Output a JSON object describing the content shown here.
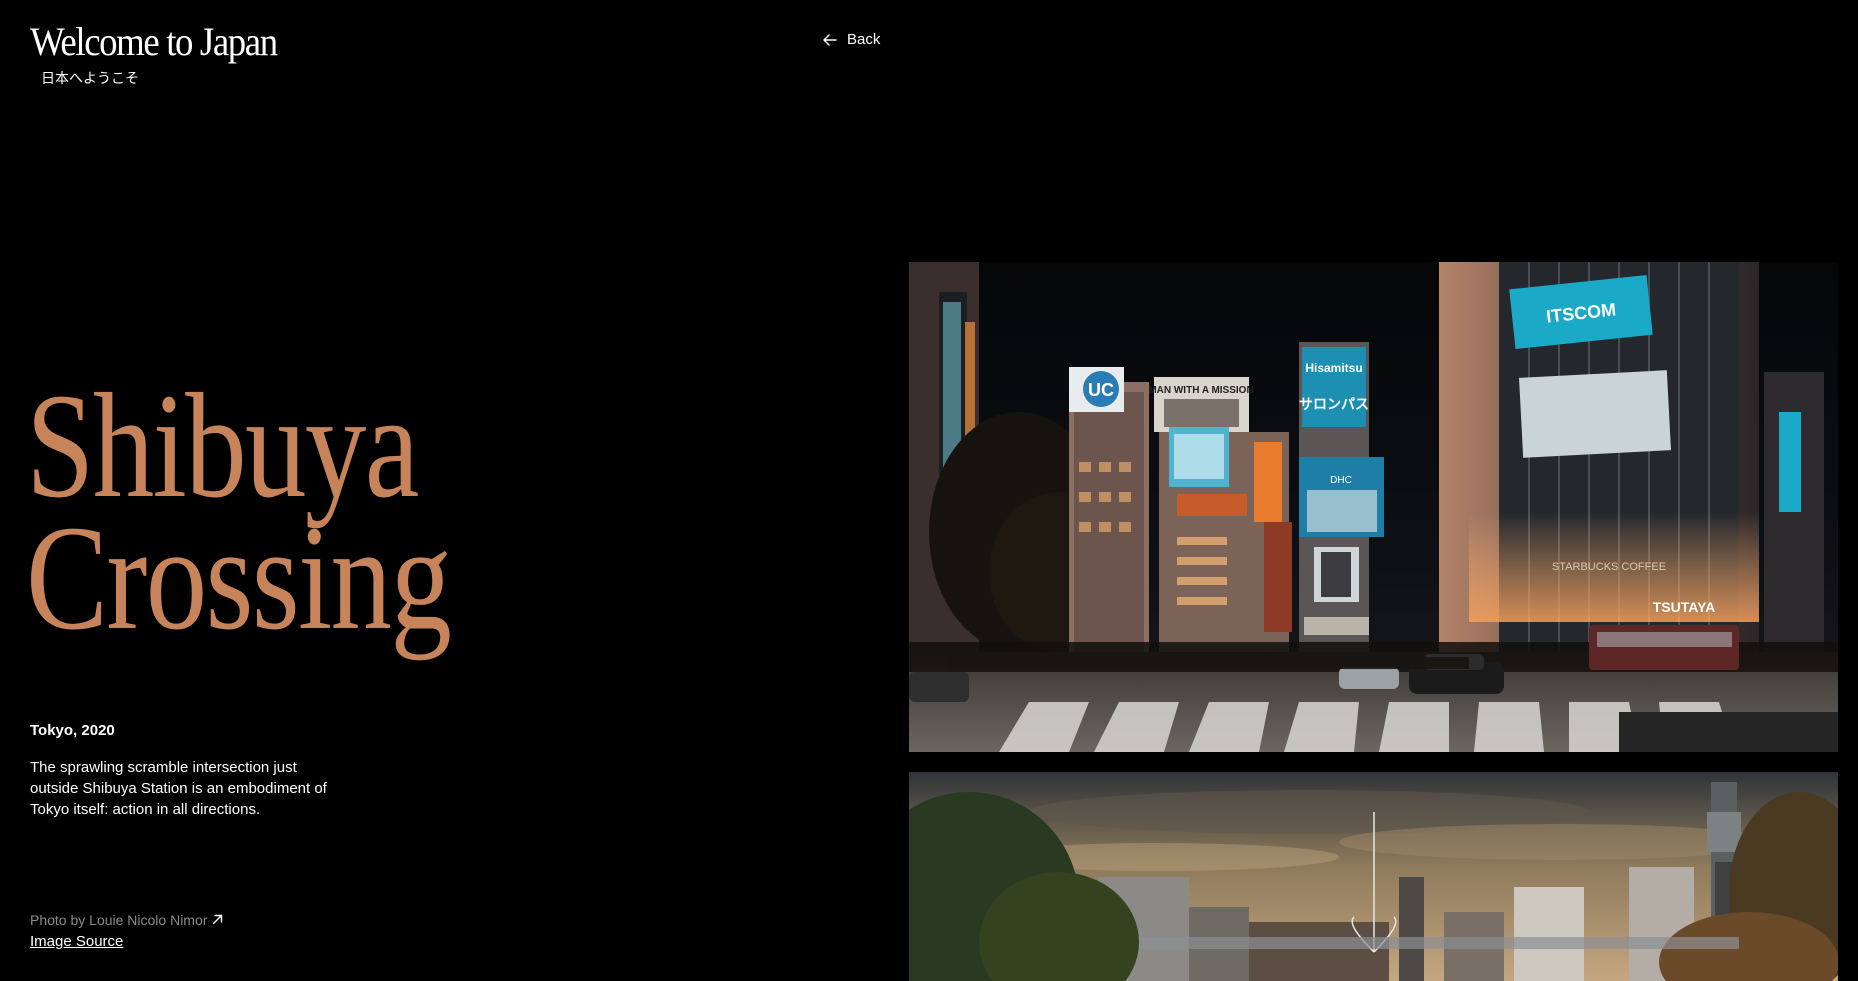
{
  "header": {
    "title": "Welcome to Japan",
    "subtitle": "日本へようこそ",
    "back_label": "Back",
    "back_icon": "arrow-left-icon"
  },
  "hero": {
    "title_line1": "Shibuya",
    "title_line2": "Crossing",
    "title_color": "#c7835a"
  },
  "details": {
    "location": "Tokyo, 2020",
    "description": "The sprawling scramble intersection just outside Shibuya Station is an embodiment of Tokyo itself: action in all directions."
  },
  "credit": {
    "photo_by": "Photo by Louie Nicolo Nimor",
    "external_icon": "arrow-up-right-icon",
    "source_label": "Image Source"
  },
  "gallery": {
    "images": [
      {
        "name": "shibuya-crossing-night-photo",
        "signs": {
          "itscom": "ITSCOM",
          "uc": "UC",
          "hisamitsu": "Hisamitsu",
          "salonpas": "サロンパス",
          "movie": "MAN WITH A MISSION",
          "dhc": "DHC",
          "tsutaya": "TSUTAYA",
          "starbucks": "STARBUCKS COFFEE"
        }
      },
      {
        "name": "osaka-skyline-tsutenkaku-photo"
      }
    ]
  }
}
